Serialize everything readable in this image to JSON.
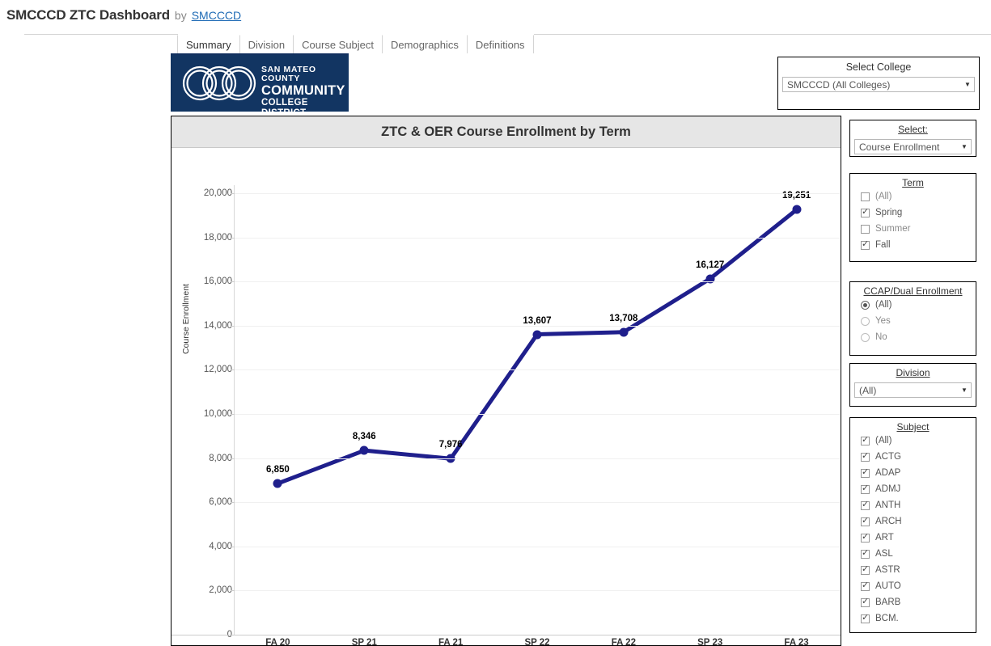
{
  "header": {
    "workbook_title": "SMCCCD ZTC Dashboard",
    "by_label": "by",
    "author_link": "SMCCCD"
  },
  "tabs": [
    {
      "label": "Summary",
      "active": true
    },
    {
      "label": "Division",
      "active": false
    },
    {
      "label": "Course Subject",
      "active": false
    },
    {
      "label": "Demographics",
      "active": false
    },
    {
      "label": "Definitions",
      "active": false
    }
  ],
  "logo": {
    "line1": "SAN MATEO COUNTY",
    "line2": "COMMUNITY",
    "line3": "COLLEGE DISTRICT",
    "background_color": "#123562",
    "icon": "three-rings-icon"
  },
  "college_filter": {
    "title": "Select College",
    "value": "SMCCCD (All Colleges)",
    "arrow_icon": "chevron-down-icon"
  },
  "select_filter": {
    "title": "Select:",
    "value": "Course Enrollment",
    "arrow_icon": "chevron-down-icon"
  },
  "term_filter": {
    "title": "Term",
    "options": [
      {
        "label": "(All)",
        "checked": false
      },
      {
        "label": "Spring",
        "checked": true
      },
      {
        "label": "Summer",
        "checked": false
      },
      {
        "label": "Fall",
        "checked": true
      }
    ]
  },
  "ccap_filter": {
    "title": "CCAP/Dual Enrollment",
    "options": [
      {
        "label": "(All)",
        "selected": true
      },
      {
        "label": "Yes",
        "selected": false
      },
      {
        "label": "No",
        "selected": false
      }
    ]
  },
  "division_filter": {
    "title": "Division",
    "value": "(All)",
    "arrow_icon": "chevron-down-icon"
  },
  "subject_filter": {
    "title": "Subject",
    "options": [
      {
        "label": "(All)",
        "checked": true
      },
      {
        "label": "ACTG",
        "checked": true
      },
      {
        "label": "ADAP",
        "checked": true
      },
      {
        "label": "ADMJ",
        "checked": true
      },
      {
        "label": "ANTH",
        "checked": true
      },
      {
        "label": "ARCH",
        "checked": true
      },
      {
        "label": "ART",
        "checked": true
      },
      {
        "label": "ASL",
        "checked": true
      },
      {
        "label": "ASTR",
        "checked": true
      },
      {
        "label": "AUTO",
        "checked": true
      },
      {
        "label": "BARB",
        "checked": true
      },
      {
        "label": "BCM.",
        "checked": true
      }
    ]
  },
  "chart_data": {
    "type": "line",
    "title": "ZTC & OER Course Enrollment by Term",
    "xlabel": "",
    "ylabel": "Course Enrollment",
    "categories": [
      "FA 20",
      "SP 21",
      "FA 21",
      "SP 22",
      "FA 22",
      "SP 23",
      "FA 23"
    ],
    "values": [
      6850,
      8346,
      7976,
      13607,
      13708,
      16127,
      19251
    ],
    "value_labels": [
      "6,850",
      "8,346",
      "7,976",
      "13,607",
      "13,708",
      "16,127",
      "19,251"
    ],
    "ylim": [
      0,
      20000
    ],
    "ytick_step": 2000,
    "ytick_labels": [
      "0",
      "2,000",
      "4,000",
      "6,000",
      "8,000",
      "10,000",
      "12,000",
      "14,000",
      "16,000",
      "18,000",
      "20,000"
    ],
    "grid": true,
    "legend": "none",
    "series_color": "#1f1f8c",
    "marker": "circle"
  }
}
